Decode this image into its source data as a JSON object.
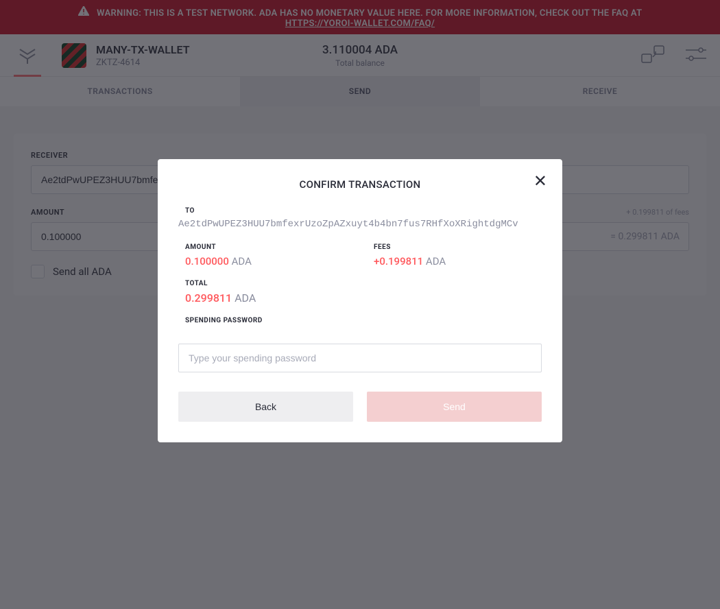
{
  "warning": {
    "text": "WARNING: THIS IS A TEST NETWORK. ADA HAS NO MONETARY VALUE HERE. FOR MORE INFORMATION, CHECK OUT THE FAQ AT",
    "link": "HTTPS://YOROI-WALLET.COM/FAQ/"
  },
  "wallet": {
    "name": "MANY-TX-WALLET",
    "id": "ZKTZ-4614"
  },
  "balance": {
    "amount": "3.110004 ADA",
    "label": "Total balance"
  },
  "tabs": {
    "transactions": "TRANSACTIONS",
    "send": "SEND",
    "receive": "RECEIVE"
  },
  "form": {
    "receiver_label": "RECEIVER",
    "receiver_value": "Ae2tdPwUPEZ3HUU7bmfe",
    "amount_label": "AMOUNT",
    "amount_hint": "+ 0.199811 of fees",
    "amount_value": "0.100000",
    "amount_suffix": "= 0.299811 ADA",
    "send_all_label": "Send all ADA"
  },
  "modal": {
    "title": "CONFIRM TRANSACTION",
    "to_label": "TO",
    "to_value": "Ae2tdPwUPEZ3HUU7bmfexrUzoZpAZxuyt4b4bn7fus7RHfXoXRightdgMCv",
    "amount_label": "AMOUNT",
    "amount_num": "0.100000",
    "amount_unit": "ADA",
    "fees_label": "FEES",
    "fees_num": "+0.199811",
    "fees_unit": "ADA",
    "total_label": "TOTAL",
    "total_num": "0.299811",
    "total_unit": "ADA",
    "password_label": "SPENDING PASSWORD",
    "password_placeholder": "Type your spending password",
    "back_button": "Back",
    "send_button": "Send"
  }
}
